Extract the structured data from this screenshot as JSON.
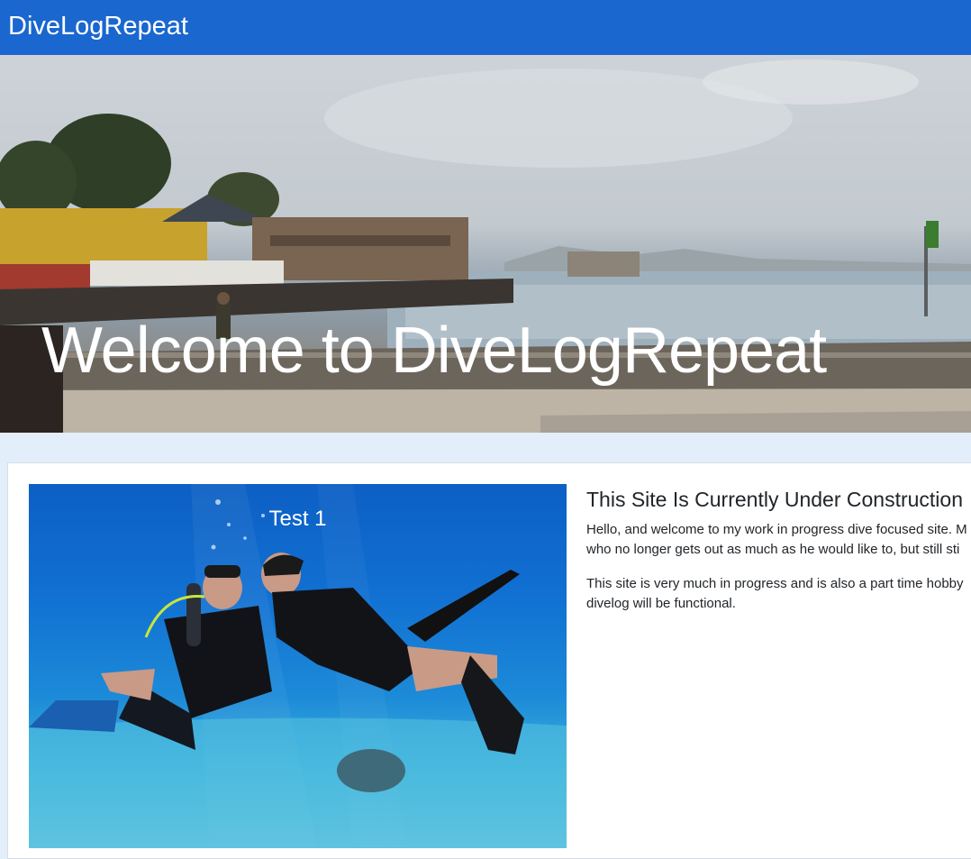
{
  "navbar": {
    "brand": "DiveLogRepeat"
  },
  "hero": {
    "title": "Welcome to DiveLogRepeat"
  },
  "feature": {
    "photo_caption": "Test 1",
    "heading": "This Site Is Currently Under Construction",
    "paragraph1": {
      "line1": "Hello, and welcome to my work in progress dive focused site. M",
      "line2": "who no longer gets out as much as he would like to, but still sti"
    },
    "paragraph2": {
      "line1": "This site is very much in progress and is also a part time hobby",
      "line2": "divelog will be functional."
    }
  },
  "colors": {
    "navbar_bg": "#1a67cf",
    "page_bg": "#e3eefb",
    "card_bg": "#ffffff",
    "text": "#212529"
  }
}
